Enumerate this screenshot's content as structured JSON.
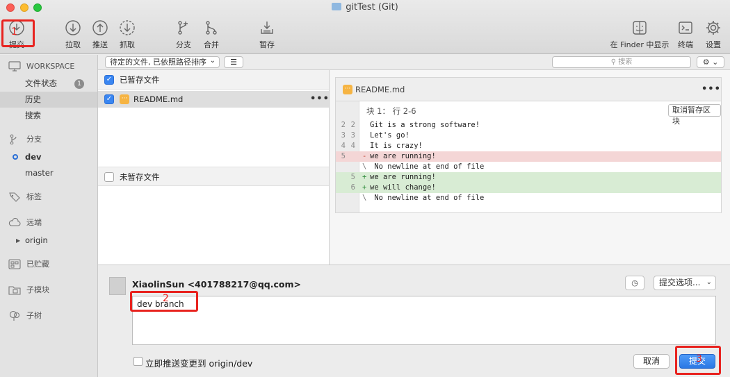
{
  "window": {
    "title": "gitTest (Git)"
  },
  "toolbar": {
    "commit": "提交",
    "pull": "拉取",
    "push": "推送",
    "fetch": "抓取",
    "branch": "分支",
    "merge": "合并",
    "stash": "暂存",
    "show_in_finder": "在 Finder 中显示",
    "terminal": "终端",
    "settings": "设置"
  },
  "sidebar": {
    "workspace_header": "WORKSPACE",
    "file_status": "文件状态",
    "file_status_badge": "1",
    "history": "历史",
    "search": "搜索",
    "branches_header": "分支",
    "branches": [
      "dev",
      "master"
    ],
    "tags_header": "标签",
    "remotes_header": "远端",
    "remote_origin": "origin",
    "stashes_header": "已贮藏",
    "submodules_header": "子模块",
    "subtrees_header": "子树"
  },
  "filter": {
    "sort_select": "待定的文件, 已依照路径排序",
    "search_placeholder": "搜索"
  },
  "staged": {
    "header": "已暂存文件",
    "files": [
      {
        "name": "README.md"
      }
    ]
  },
  "unstaged": {
    "header": "未暂存文件"
  },
  "diff": {
    "file": "README.md",
    "hunk_header": "块 1： 行 2-6",
    "unstage_hunk_button": "取消暂存区块",
    "lines": [
      {
        "old": "2",
        "new": "2",
        "marker": "",
        "text": "Git is a strong software!",
        "type": "ctx"
      },
      {
        "old": "3",
        "new": "3",
        "marker": "",
        "text": "Let's go!",
        "type": "ctx"
      },
      {
        "old": "4",
        "new": "4",
        "marker": "",
        "text": "It is crazy!",
        "type": "ctx"
      },
      {
        "old": "5",
        "new": "",
        "marker": "-",
        "text": "we are running!",
        "type": "del"
      },
      {
        "old": "",
        "new": "",
        "marker": "\\",
        "text": " No newline at end of file",
        "type": "ctx"
      },
      {
        "old": "",
        "new": "5",
        "marker": "+",
        "text": "we are running!",
        "type": "add"
      },
      {
        "old": "",
        "new": "6",
        "marker": "+",
        "text": "we will change!",
        "type": "add"
      },
      {
        "old": "",
        "new": "",
        "marker": "\\",
        "text": " No newline at end of file",
        "type": "ctx"
      }
    ]
  },
  "commit": {
    "author": "XiaolinSun <401788217@qq.com>",
    "options_button": "提交选项...",
    "message": "dev branch",
    "push_checkbox_label": "立即推送变更到 origin/dev",
    "cancel_button": "取消",
    "commit_button": "提交"
  },
  "annotations": [
    "1",
    "2",
    "3"
  ],
  "colors": {
    "annotation_red": "#e8231f",
    "accent_blue": "#3a86f1",
    "modified_orange": "#f6b443"
  }
}
